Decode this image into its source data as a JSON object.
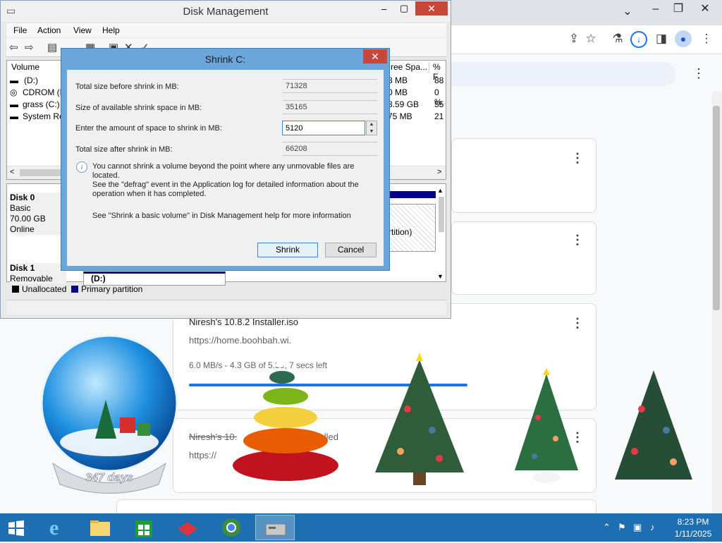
{
  "colors": {
    "taskbar": "#1e6fb1",
    "dialog_frame": "#6ca5d9",
    "close_red": "#c7483b",
    "chrome_blue": "#1a73e8",
    "unallocated": "#000000",
    "primary_partition": "#00008b"
  },
  "chrome": {
    "downloads": [
      {
        "title": "",
        "url": "",
        "status": ""
      },
      {
        "title": "",
        "url": "",
        "status": ""
      },
      {
        "title": "Niresh's 10.8.2 Installer.iso",
        "url": "https://home.boohbah.wi.",
        "status": "6.0 MB/s - 4.3 GB of 5.39, 7 secs left",
        "progress": 0.8
      },
      {
        "title": "Niresh's 10.",
        "url": "https://",
        "status": "celled"
      }
    ]
  },
  "disk_management": {
    "title": "Disk Management",
    "menu": [
      "File",
      "Action",
      "View",
      "Help"
    ],
    "columns": [
      "Volume",
      "ree Spa...",
      "% F"
    ],
    "volumes": [
      {
        "name": "(D:)",
        "free": "8 MB",
        "pct": "88"
      },
      {
        "name": "CDROM (E",
        "free": "0 MB",
        "pct": "0 %"
      },
      {
        "name": "grass (C:)",
        "free": "8.59 GB",
        "pct": "55"
      },
      {
        "name": "System Res",
        "free": "75 MB",
        "pct": "21"
      }
    ],
    "disk0": {
      "name": "Disk 0",
      "type": "Basic",
      "size": "70.00 GB",
      "status": "Online",
      "partition_label": "rtition)"
    },
    "disk1": {
      "name": "Disk 1",
      "type": "Removable",
      "volume": "(D:)"
    },
    "legend": {
      "unallocated": "Unallocated",
      "primary": "Primary partition"
    }
  },
  "shrink": {
    "title": "Shrink C:",
    "total_before_label": "Total size before shrink in MB:",
    "total_before_value": "71328",
    "available_label": "Size of available shrink space in MB:",
    "available_value": "35165",
    "enter_label": "Enter the amount of space to shrink in MB:",
    "enter_value": "5120",
    "total_after_label": "Total size after shrink in MB:",
    "total_after_value": "66208",
    "note_line1": "You cannot shrink a volume beyond the point where any unmovable files are located.",
    "note_line2": "See the \"defrag\" event in the Application log for detailed information about the",
    "note_line3": "operation when it has completed.",
    "help": "See \"Shrink a basic volume\" in Disk Management help for more information",
    "shrink_button": "Shrink",
    "cancel_button": "Cancel"
  },
  "desktop": {
    "snow_globe_text": "347 days"
  },
  "taskbar": {
    "apps": [
      "start-icon",
      "internet-explorer-icon",
      "file-explorer-icon",
      "store-icon",
      "app-red-icon",
      "chrome-icon",
      "disk-management-icon"
    ],
    "time": "8:23 PM",
    "date": "1/11/2025"
  }
}
